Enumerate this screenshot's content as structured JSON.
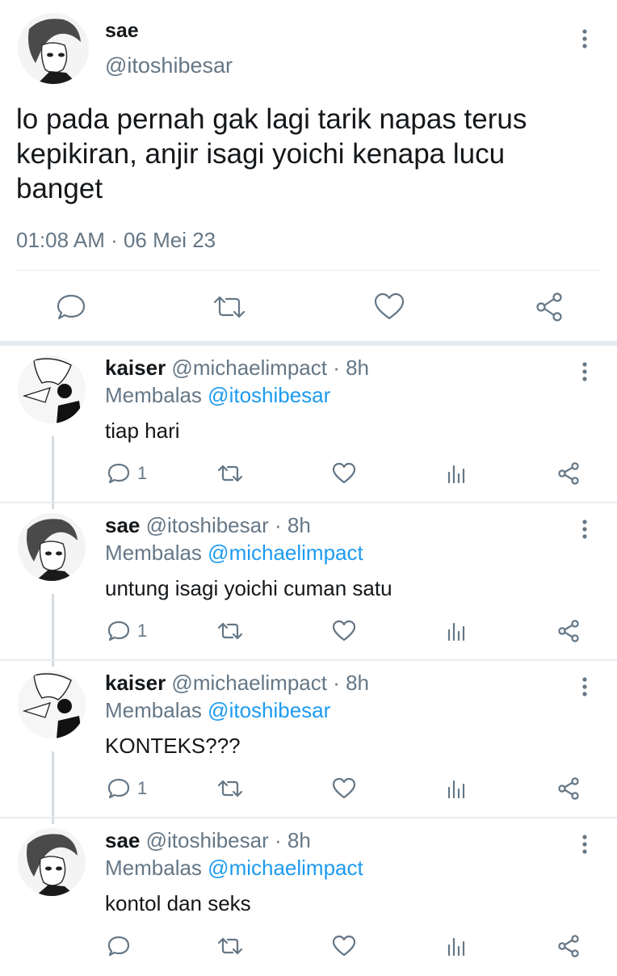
{
  "main_tweet": {
    "name": "sae",
    "handle": "@itoshibesar",
    "text": "lo pada pernah gak lagi tarik napas terus kepikiran, anjir isagi yoichi kenapa lucu banget",
    "time": "01:08 AM · 06 Mei 23",
    "actions": [
      "reply-icon",
      "retweet-icon",
      "like-icon",
      "share-icon"
    ]
  },
  "replies": [
    {
      "name": "kaiser",
      "handle_time": "@michaelimpact · 8h",
      "replying_prefix": "Membalas",
      "replying_to": "@itoshibesar",
      "text": "tiap hari",
      "reply_count": "1"
    },
    {
      "name": "sae",
      "handle_time": "@itoshibesar · 8h",
      "replying_prefix": "Membalas",
      "replying_to": "@michaelimpact",
      "text": "untung isagi yoichi cuman satu",
      "reply_count": "1"
    },
    {
      "name": "kaiser",
      "handle_time": "@michaelimpact · 8h",
      "replying_prefix": "Membalas",
      "replying_to": "@itoshibesar",
      "text": "KONTEKS???",
      "reply_count": "1"
    },
    {
      "name": "sae",
      "handle_time": "@itoshibesar · 8h",
      "replying_prefix": "Membalas",
      "replying_to": "@michaelimpact",
      "text": "kontol dan seks",
      "reply_count": ""
    }
  ],
  "colors": {
    "link": "#1d9bf0",
    "muted": "#657786",
    "divider": "#e6ecf0"
  }
}
